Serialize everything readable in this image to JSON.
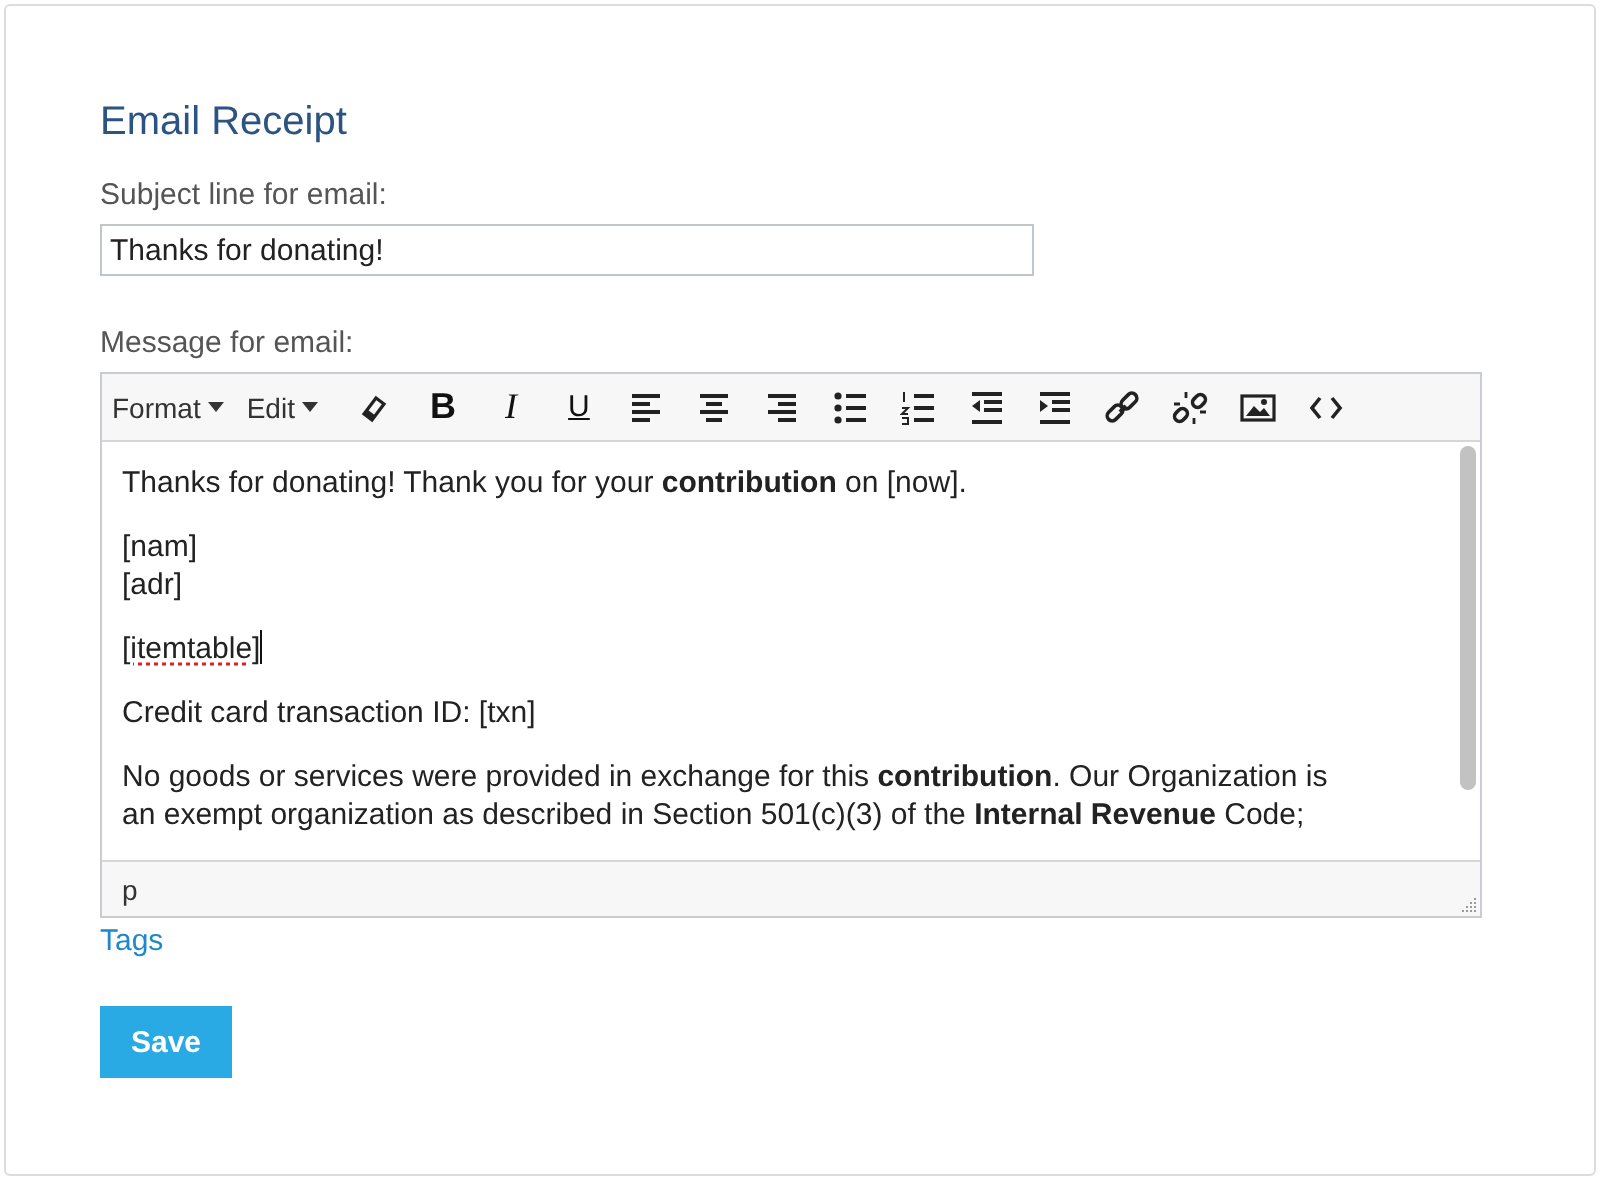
{
  "title": "Email Receipt",
  "subject": {
    "label": "Subject line for email:",
    "value": "Thanks for donating!"
  },
  "message": {
    "label": "Message for email:",
    "toolbar": [
      {
        "kind": "menu",
        "label": "Format"
      },
      {
        "kind": "menu",
        "label": "Edit"
      },
      {
        "kind": "icon"
      },
      {
        "kind": "glyph",
        "label": "B"
      },
      {
        "kind": "glyph",
        "label": "I"
      },
      {
        "kind": "glyph",
        "label": "U"
      },
      {
        "kind": "icon"
      },
      {
        "kind": "icon"
      },
      {
        "kind": "icon"
      },
      {
        "kind": "icon"
      },
      {
        "kind": "icon"
      },
      {
        "kind": "icon"
      },
      {
        "kind": "icon"
      },
      {
        "kind": "icon"
      },
      {
        "kind": "icon"
      },
      {
        "kind": "icon"
      },
      {
        "kind": "icon"
      }
    ],
    "paragraphs": [
      {
        "lines": [
          "Thanks for donating! Thank you for your **contribution** on [now]."
        ]
      },
      {
        "lines": [
          "[nam]",
          "[adr]"
        ]
      },
      {
        "lines": [
          "[itemtable]"
        ],
        "misspelled": true,
        "cursor": true
      },
      {
        "lines": [
          "Credit card transaction ID: [txn]"
        ]
      },
      {
        "lines": [
          "No goods or services were provided in exchange for this **contribution**. Our Organization is an exempt organization as described in Section 501(c)(3) of the **Internal Revenue** Code;"
        ]
      }
    ],
    "status_path": "p"
  },
  "tags_link": "Tags",
  "save_button": "Save"
}
